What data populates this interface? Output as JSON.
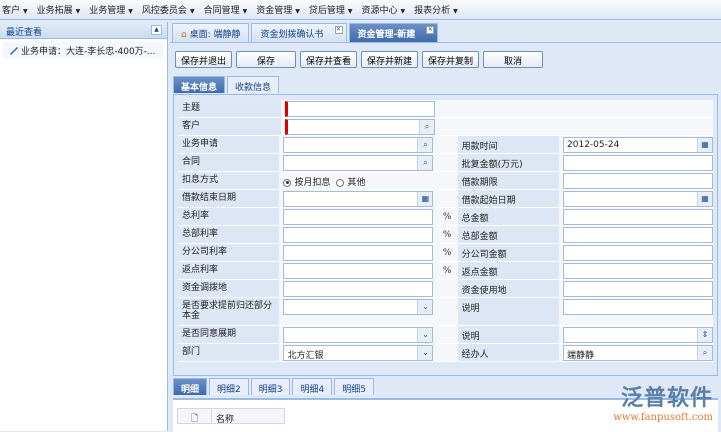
{
  "menubar": [
    "客户",
    "业务拓展",
    "业务管理",
    "风控委员会",
    "合同管理",
    "资金管理",
    "贷后管理",
    "资源中心",
    "报表分析"
  ],
  "left": {
    "title": "最近查看",
    "items": [
      "业务申请：大连-李长忠-400万-..."
    ]
  },
  "tabs": [
    {
      "label": "桌面: 端静静",
      "closable": false
    },
    {
      "label": "资金划拨确认书",
      "closable": true
    },
    {
      "label": "资金管理-新建",
      "closable": true,
      "active": true
    }
  ],
  "toolbar": [
    "保存并退出",
    "保存",
    "保存并查看",
    "保存并新建",
    "保存并复制",
    "取消"
  ],
  "subtabs": [
    "基本信息",
    "收款信息"
  ],
  "form": {
    "subject": "主题",
    "customer": "客户",
    "rows": [
      {
        "l": "业务申请",
        "icon": "search",
        "l2": "用款时间",
        "v2": "2012-05-24",
        "icon2": "calendar"
      },
      {
        "l": "合同",
        "icon": "search",
        "l2": "批复金额(万元)"
      },
      {
        "l": "扣息方式",
        "radio": true,
        "l2": "借款期限"
      },
      {
        "l": "借款结束日期",
        "icon": "calendar",
        "l2": "借款起始日期",
        "icon2": "calendar"
      },
      {
        "l": "总利率",
        "pct": "%",
        "l2": "总金额"
      },
      {
        "l": "总部利率",
        "pct": "%",
        "l2": "总部金额"
      },
      {
        "l": "分公司利率",
        "pct": "%",
        "l2": "分公司金额"
      },
      {
        "l": "返点利率",
        "pct": "%",
        "l2": "返点金额"
      },
      {
        "l": "资金调拨地",
        "l2": "资金使用地"
      },
      {
        "l": "是否要求提前归还部分本金",
        "icon": "dropdown",
        "l2": "说明",
        "tall": true
      },
      {
        "l": "是否同意展期",
        "icon": "dropdown",
        "l2": "说明",
        "icon2": "spinner"
      },
      {
        "l": "部门",
        "v": "北方汇银",
        "icon": "dropdown",
        "l2": "经办人",
        "v2": "端静静",
        "icon2": "search"
      }
    ],
    "radio_options": [
      "按月扣息",
      "其他"
    ]
  },
  "bottom_tabs": [
    "明细",
    "明细2",
    "明细3",
    "明细4",
    "明细5"
  ],
  "grid": {
    "columns": [
      "名称"
    ]
  },
  "logo": {
    "name": "泛普软件",
    "url": "www.fanpusoft.com"
  }
}
